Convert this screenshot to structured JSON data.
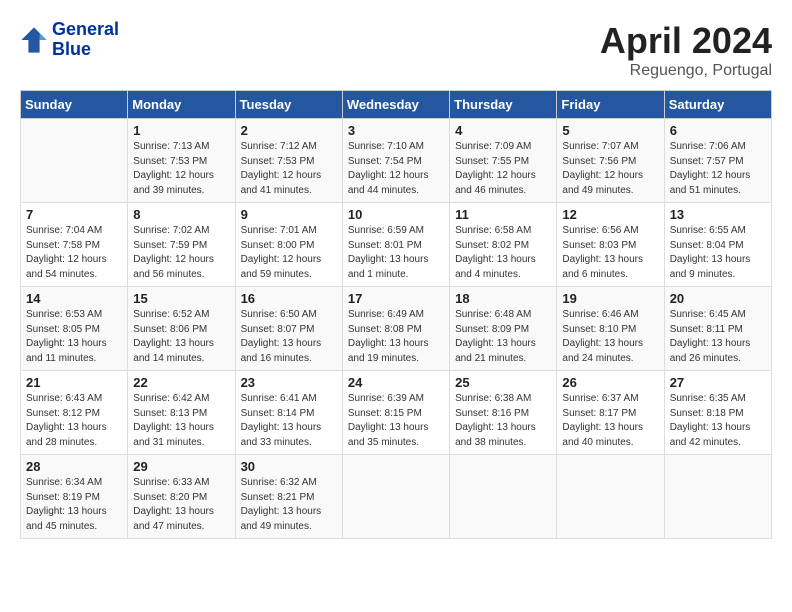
{
  "header": {
    "logo_line1": "General",
    "logo_line2": "Blue",
    "month": "April 2024",
    "location": "Reguengo, Portugal"
  },
  "days_of_week": [
    "Sunday",
    "Monday",
    "Tuesday",
    "Wednesday",
    "Thursday",
    "Friday",
    "Saturday"
  ],
  "weeks": [
    [
      {
        "day": "",
        "info": ""
      },
      {
        "day": "1",
        "info": "Sunrise: 7:13 AM\nSunset: 7:53 PM\nDaylight: 12 hours\nand 39 minutes."
      },
      {
        "day": "2",
        "info": "Sunrise: 7:12 AM\nSunset: 7:53 PM\nDaylight: 12 hours\nand 41 minutes."
      },
      {
        "day": "3",
        "info": "Sunrise: 7:10 AM\nSunset: 7:54 PM\nDaylight: 12 hours\nand 44 minutes."
      },
      {
        "day": "4",
        "info": "Sunrise: 7:09 AM\nSunset: 7:55 PM\nDaylight: 12 hours\nand 46 minutes."
      },
      {
        "day": "5",
        "info": "Sunrise: 7:07 AM\nSunset: 7:56 PM\nDaylight: 12 hours\nand 49 minutes."
      },
      {
        "day": "6",
        "info": "Sunrise: 7:06 AM\nSunset: 7:57 PM\nDaylight: 12 hours\nand 51 minutes."
      }
    ],
    [
      {
        "day": "7",
        "info": "Sunrise: 7:04 AM\nSunset: 7:58 PM\nDaylight: 12 hours\nand 54 minutes."
      },
      {
        "day": "8",
        "info": "Sunrise: 7:02 AM\nSunset: 7:59 PM\nDaylight: 12 hours\nand 56 minutes."
      },
      {
        "day": "9",
        "info": "Sunrise: 7:01 AM\nSunset: 8:00 PM\nDaylight: 12 hours\nand 59 minutes."
      },
      {
        "day": "10",
        "info": "Sunrise: 6:59 AM\nSunset: 8:01 PM\nDaylight: 13 hours\nand 1 minute."
      },
      {
        "day": "11",
        "info": "Sunrise: 6:58 AM\nSunset: 8:02 PM\nDaylight: 13 hours\nand 4 minutes."
      },
      {
        "day": "12",
        "info": "Sunrise: 6:56 AM\nSunset: 8:03 PM\nDaylight: 13 hours\nand 6 minutes."
      },
      {
        "day": "13",
        "info": "Sunrise: 6:55 AM\nSunset: 8:04 PM\nDaylight: 13 hours\nand 9 minutes."
      }
    ],
    [
      {
        "day": "14",
        "info": "Sunrise: 6:53 AM\nSunset: 8:05 PM\nDaylight: 13 hours\nand 11 minutes."
      },
      {
        "day": "15",
        "info": "Sunrise: 6:52 AM\nSunset: 8:06 PM\nDaylight: 13 hours\nand 14 minutes."
      },
      {
        "day": "16",
        "info": "Sunrise: 6:50 AM\nSunset: 8:07 PM\nDaylight: 13 hours\nand 16 minutes."
      },
      {
        "day": "17",
        "info": "Sunrise: 6:49 AM\nSunset: 8:08 PM\nDaylight: 13 hours\nand 19 minutes."
      },
      {
        "day": "18",
        "info": "Sunrise: 6:48 AM\nSunset: 8:09 PM\nDaylight: 13 hours\nand 21 minutes."
      },
      {
        "day": "19",
        "info": "Sunrise: 6:46 AM\nSunset: 8:10 PM\nDaylight: 13 hours\nand 24 minutes."
      },
      {
        "day": "20",
        "info": "Sunrise: 6:45 AM\nSunset: 8:11 PM\nDaylight: 13 hours\nand 26 minutes."
      }
    ],
    [
      {
        "day": "21",
        "info": "Sunrise: 6:43 AM\nSunset: 8:12 PM\nDaylight: 13 hours\nand 28 minutes."
      },
      {
        "day": "22",
        "info": "Sunrise: 6:42 AM\nSunset: 8:13 PM\nDaylight: 13 hours\nand 31 minutes."
      },
      {
        "day": "23",
        "info": "Sunrise: 6:41 AM\nSunset: 8:14 PM\nDaylight: 13 hours\nand 33 minutes."
      },
      {
        "day": "24",
        "info": "Sunrise: 6:39 AM\nSunset: 8:15 PM\nDaylight: 13 hours\nand 35 minutes."
      },
      {
        "day": "25",
        "info": "Sunrise: 6:38 AM\nSunset: 8:16 PM\nDaylight: 13 hours\nand 38 minutes."
      },
      {
        "day": "26",
        "info": "Sunrise: 6:37 AM\nSunset: 8:17 PM\nDaylight: 13 hours\nand 40 minutes."
      },
      {
        "day": "27",
        "info": "Sunrise: 6:35 AM\nSunset: 8:18 PM\nDaylight: 13 hours\nand 42 minutes."
      }
    ],
    [
      {
        "day": "28",
        "info": "Sunrise: 6:34 AM\nSunset: 8:19 PM\nDaylight: 13 hours\nand 45 minutes."
      },
      {
        "day": "29",
        "info": "Sunrise: 6:33 AM\nSunset: 8:20 PM\nDaylight: 13 hours\nand 47 minutes."
      },
      {
        "day": "30",
        "info": "Sunrise: 6:32 AM\nSunset: 8:21 PM\nDaylight: 13 hours\nand 49 minutes."
      },
      {
        "day": "",
        "info": ""
      },
      {
        "day": "",
        "info": ""
      },
      {
        "day": "",
        "info": ""
      },
      {
        "day": "",
        "info": ""
      }
    ]
  ]
}
